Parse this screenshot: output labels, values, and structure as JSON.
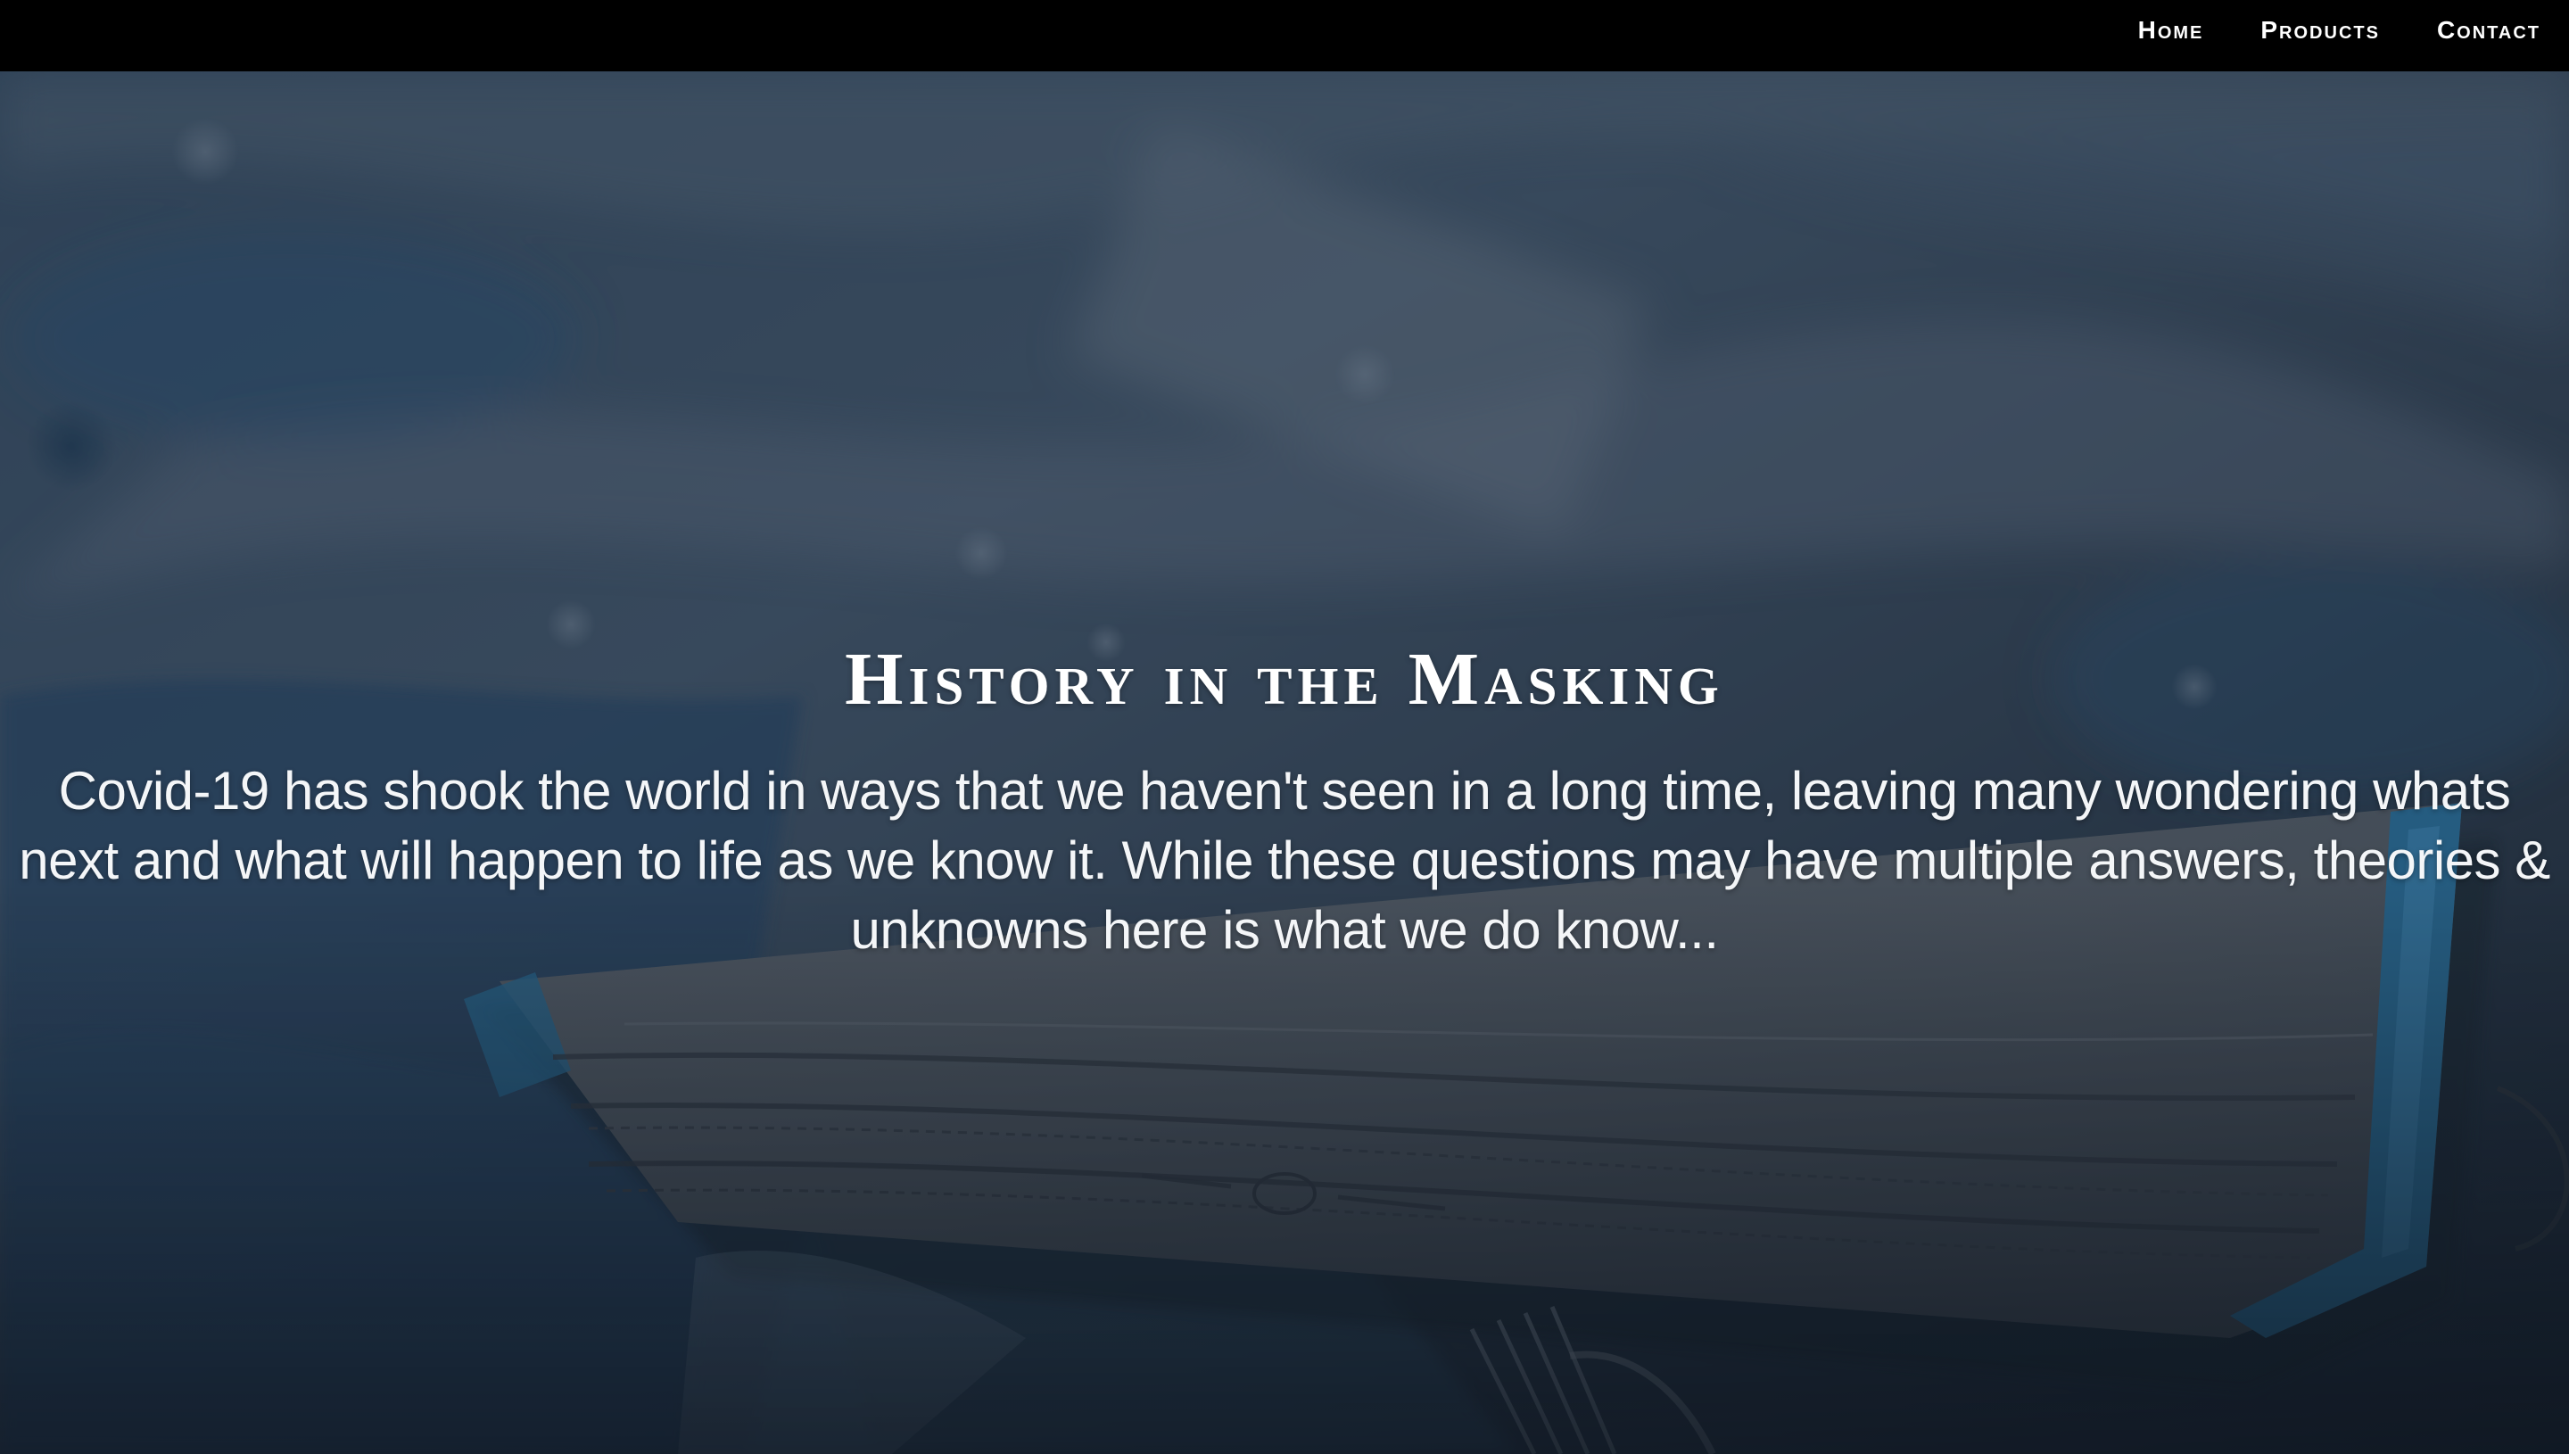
{
  "nav": {
    "items": [
      {
        "label": "Home"
      },
      {
        "label": "Products"
      },
      {
        "label": "Contact"
      }
    ]
  },
  "hero": {
    "title": "History in the Masking",
    "text": "Covid-19 has shook the world in ways that we haven't seen in a long time, leaving many wondering whats next and what will happen to life as we know it. While these questions may have multiple answers, theories & unknowns here is what we do know...",
    "background_image": "surgical-mask-photo"
  },
  "colors": {
    "navbar_bg": "#000000",
    "nav_text": "#ffffff",
    "hero_text": "#ffffff",
    "mask_blue_trim": "#2f7fb0",
    "mask_body_gray": "#5c6570"
  }
}
